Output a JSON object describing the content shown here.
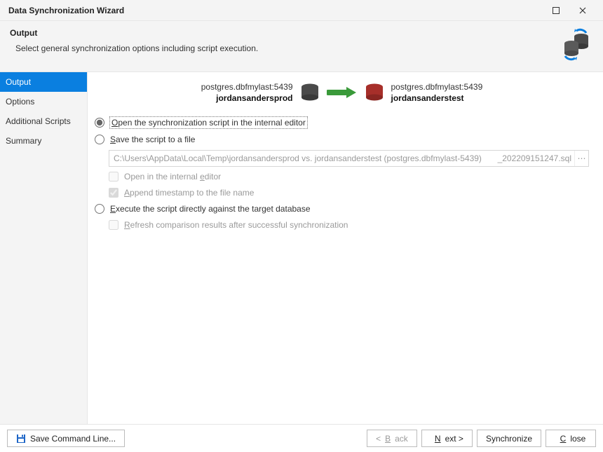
{
  "window": {
    "title": "Data Synchronization Wizard"
  },
  "header": {
    "title": "Output",
    "subtitle": "Select general synchronization options including script execution."
  },
  "sidebar": {
    "items": [
      {
        "label": "Output",
        "active": true
      },
      {
        "label": "Options",
        "active": false
      },
      {
        "label": "Additional Scripts",
        "active": false
      },
      {
        "label": "Summary",
        "active": false
      }
    ]
  },
  "db": {
    "source": {
      "conn": "postgres.dbfmylast:5439",
      "name": "jordansandersprod"
    },
    "target": {
      "conn": "postgres.dbfmylast:5439",
      "name": "jordansanderstest"
    },
    "colors": {
      "source": "#4a4a4a",
      "target": "#a72f2a",
      "arrow": "#3a9a3a"
    }
  },
  "options": {
    "radio_open_editor": {
      "prefix": "",
      "mn": "O",
      "rest": "pen the synchronization script in the internal editor"
    },
    "radio_save_file": {
      "prefix": "",
      "mn": "S",
      "rest": "ave the script to a file"
    },
    "radio_execute": {
      "prefix": "",
      "mn": "E",
      "rest": "xecute the script directly against the target database"
    },
    "path": {
      "value": "C:\\Users\\AppData\\Local\\Temp\\jordansandersprod vs. jordansanderstest (postgres.dbfmylast-5439)",
      "suffix": "_202209151247.sql"
    },
    "chk_open_internal": {
      "prefix": "Open in the internal ",
      "mn": "e",
      "rest": "ditor"
    },
    "chk_append_ts": {
      "prefix": "",
      "mn": "A",
      "rest": "ppend timestamp to the file name"
    },
    "chk_refresh": {
      "prefix": "",
      "mn": "R",
      "rest": "efresh comparison results after successful synchronization"
    }
  },
  "footer": {
    "save_cmd": "Save Command Line...",
    "back": {
      "prefix": "< ",
      "mn": "B",
      "rest": "ack"
    },
    "next": {
      "prefix": "",
      "mn": "N",
      "rest": "ext >"
    },
    "sync": {
      "label": "Synchronize"
    },
    "close": {
      "prefix": "",
      "mn": "C",
      "rest": "lose"
    }
  }
}
